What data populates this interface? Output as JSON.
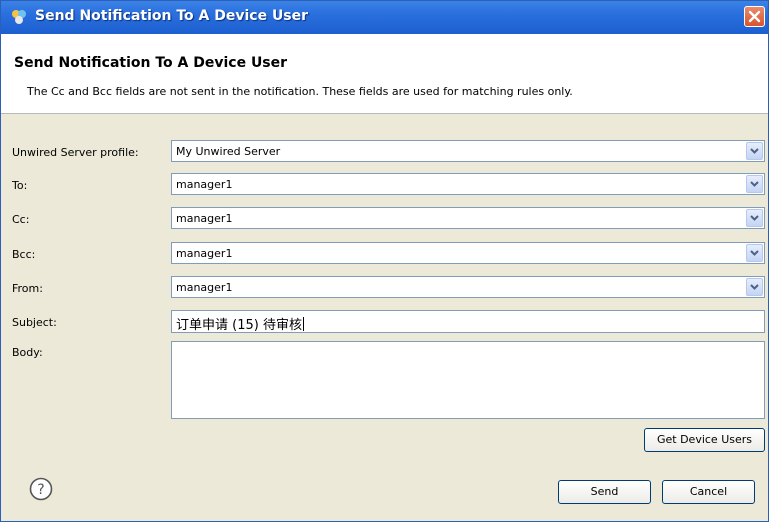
{
  "window": {
    "title": "Send Notification To A Device User"
  },
  "header": {
    "title": "Send Notification To A Device User",
    "description": "The Cc and Bcc fields are not sent in the notification.  These fields are used for matching rules only."
  },
  "form": {
    "profile": {
      "label": "Unwired Server profile:",
      "value": "My Unwired Server"
    },
    "to": {
      "label": "To:",
      "value": "manager1"
    },
    "cc": {
      "label": "Cc:",
      "value": "manager1"
    },
    "bcc": {
      "label": "Bcc:",
      "value": "manager1"
    },
    "from": {
      "label": "From:",
      "value": "manager1"
    },
    "subject": {
      "label": "Subject:",
      "value": "订单申请 (15) 待审核"
    },
    "body": {
      "label": "Body:",
      "value": ""
    }
  },
  "buttons": {
    "get_device_users": "Get Device Users",
    "send": "Send",
    "cancel": "Cancel"
  },
  "icons": {
    "title": "app-icon",
    "close": "close-icon",
    "help": "help-icon",
    "dropdown": "chevron-down-icon"
  },
  "colors": {
    "titlebar": "#2a6fde",
    "close_button": "#d9542c",
    "dialog_bg": "#ece9d8",
    "field_border": "#7f9db9"
  }
}
